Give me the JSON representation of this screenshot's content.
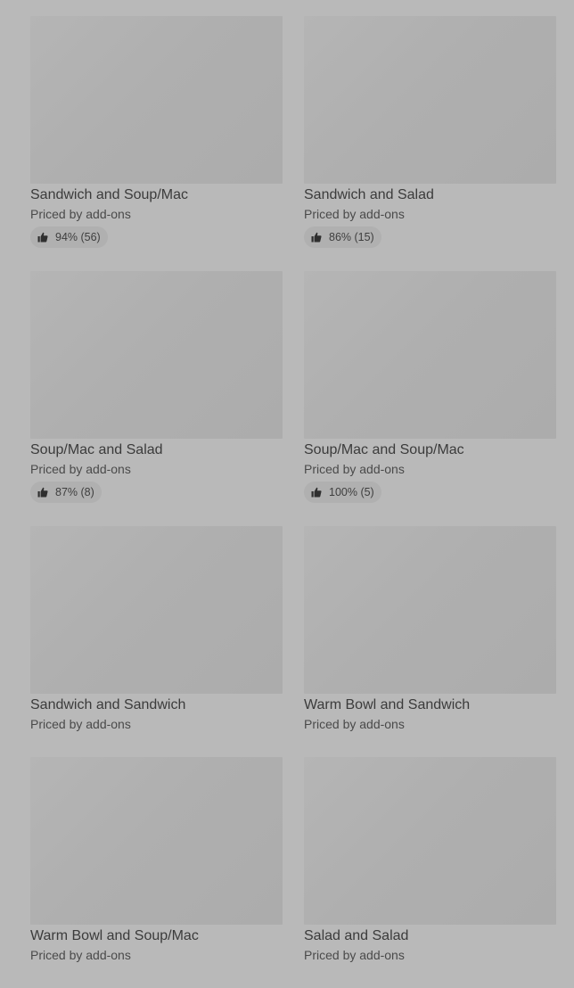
{
  "items": [
    {
      "title": "Sandwich and Soup/Mac",
      "subtitle": "Priced by add-ons",
      "rating": "94% (56)"
    },
    {
      "title": "Sandwich and Salad",
      "subtitle": "Priced by add-ons",
      "rating": "86% (15)"
    },
    {
      "title": "Soup/Mac and Salad",
      "subtitle": "Priced by add-ons",
      "rating": "87% (8)"
    },
    {
      "title": "Soup/Mac and Soup/Mac",
      "subtitle": "Priced by add-ons",
      "rating": "100% (5)"
    },
    {
      "title": "Sandwich and Sandwich",
      "subtitle": "Priced by add-ons"
    },
    {
      "title": "Warm Bowl and Sandwich",
      "subtitle": "Priced by add-ons"
    },
    {
      "title": "Warm Bowl and Soup/Mac",
      "subtitle": "Priced by add-ons"
    },
    {
      "title": "Salad and Salad",
      "subtitle": "Priced by add-ons"
    }
  ],
  "icons": {
    "rating": "thumbs-up-icon"
  }
}
